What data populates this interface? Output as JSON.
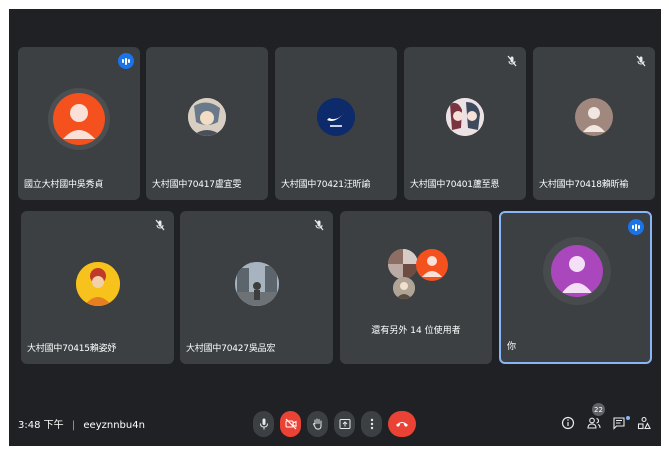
{
  "participants": [
    {
      "name": "國立大村國中吳秀貞",
      "status": "speaking",
      "avatar": "initial-avatar",
      "color": "#f4511e"
    },
    {
      "name": "大村國中70417盧宜雯",
      "status": "none",
      "avatar": "anime-photo"
    },
    {
      "name": "大村國中70421汪昕諭",
      "status": "none",
      "avatar": "logo-photo"
    },
    {
      "name": "大村國中70401蘆至恩",
      "status": "muted",
      "avatar": "anime-photo"
    },
    {
      "name": "大村國中70418賴昕褕",
      "status": "muted",
      "avatar": "default-avatar",
      "color": "#a1887f"
    },
    {
      "name": "大村國中70415賴姿妤",
      "status": "muted",
      "avatar": "anime-photo"
    },
    {
      "name": "大村國中70427吳品宏",
      "status": "muted",
      "avatar": "street-photo"
    },
    {
      "name": "還有另外 14 位使用者",
      "status": "none",
      "avatar": "group-avatars",
      "color": "#f4511e"
    },
    {
      "name": "你",
      "status": "speaking",
      "avatar": "default-avatar",
      "color": "#ab47bc"
    }
  ],
  "footer": {
    "time": "3:48 下午",
    "meeting_code": "eeyznnbu4n",
    "participant_count": "22"
  },
  "colors": {
    "background": "#202124",
    "tile": "#3c4043",
    "active_border": "#8ab4f8",
    "red": "#ea4335",
    "speaking_badge": "#1a73e8"
  },
  "icons": {
    "mic": "mic-icon",
    "camera_off": "camera-off-icon",
    "raise_hand": "raise-hand-icon",
    "present": "present-screen-icon",
    "more": "more-options-icon",
    "leave": "leave-call-icon",
    "info": "info-icon",
    "people": "people-icon",
    "chat": "chat-icon",
    "activities": "activities-icon"
  }
}
